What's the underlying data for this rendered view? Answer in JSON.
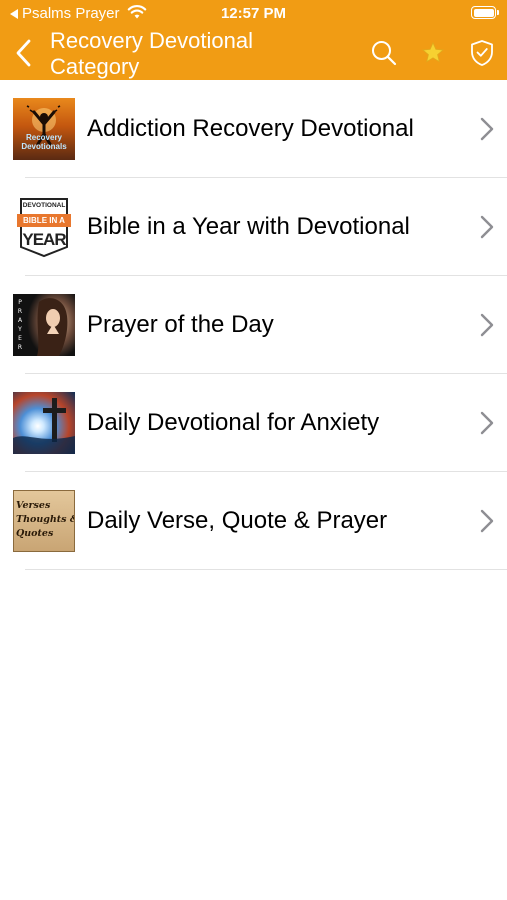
{
  "status_bar": {
    "back_app": "Psalms Prayer",
    "time": "12:57 PM"
  },
  "nav": {
    "title": "Recovery Devotional Category",
    "icons": {
      "back": "chevron-left-icon",
      "search": "search-icon",
      "favorites": "star-icon",
      "shield": "shield-check-icon"
    }
  },
  "categories": [
    {
      "label": "Addiction Recovery Devotional",
      "thumb_text": "Recovery Devotionals"
    },
    {
      "label": "Bible in a Year with Devotional",
      "thumb_text_top": "DEVOTIONAL",
      "thumb_text_mid": "BIBLE IN A",
      "thumb_text_bottom": "YEAR"
    },
    {
      "label": "Prayer of the Day",
      "thumb_text": "P R A Y E R"
    },
    {
      "label": "Daily Devotional for Anxiety"
    },
    {
      "label": "Daily Verse, Quote & Prayer",
      "thumb_text": "Verses\nThoughts &\nQuotes"
    }
  ],
  "colors": {
    "header_orange": "#f19c14",
    "chevron_gray": "#8e8e93",
    "separator": "#e2e2e2",
    "star_gold": "#f7d131"
  }
}
